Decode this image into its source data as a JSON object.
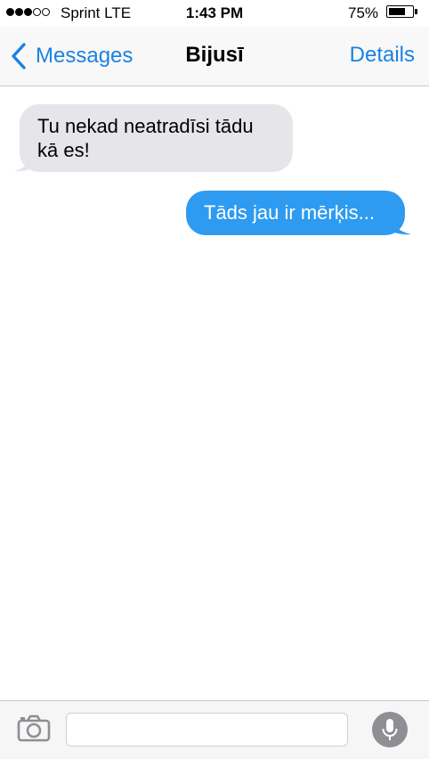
{
  "status_bar": {
    "signal_dots_filled": 3,
    "signal_dots_total": 5,
    "carrier": "Sprint  LTE",
    "time": "1:43 PM",
    "battery_percent_label": "75%",
    "battery_level": 0.75
  },
  "nav": {
    "back_label": "Messages",
    "title": "Bijusī",
    "details_label": "Details",
    "accent_color": "#1a82e2"
  },
  "messages": [
    {
      "direction": "received",
      "text": "Tu nekad neatradīsi tādu kā es!",
      "bubble_color": "#e6e5ea"
    },
    {
      "direction": "sent",
      "text": "Tāds jau ir mērķis...",
      "bubble_color": "#2e9bf0"
    }
  ],
  "input_bar": {
    "camera_icon": "camera-icon",
    "message_value": "",
    "mic_icon": "microphone-icon"
  }
}
